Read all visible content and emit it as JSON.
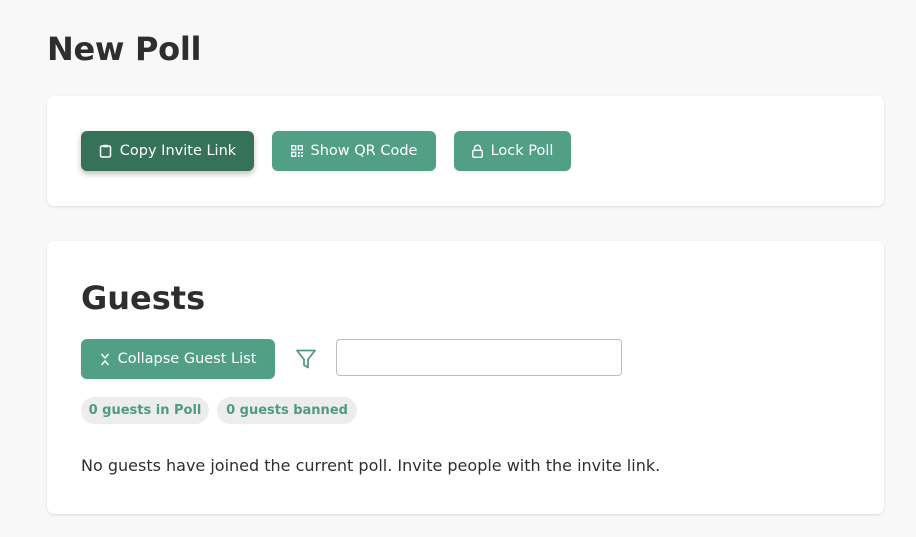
{
  "page": {
    "title": "New Poll"
  },
  "actions": {
    "copy_invite_label": "Copy Invite Link",
    "show_qr_label": "Show QR Code",
    "lock_poll_label": "Lock Poll"
  },
  "guests": {
    "title": "Guests",
    "collapse_label": "Collapse Guest List",
    "search_placeholder": "",
    "search_value": "",
    "guests_in_poll": "0 guests in Poll",
    "guests_banned": "0 guests banned",
    "empty_message": "No guests have joined the current poll. Invite people with the invite link."
  },
  "colors": {
    "primary": "#51a085",
    "primary_dark": "#367259",
    "pill_bg": "#ededed",
    "pill_text": "#4e9c80",
    "page_bg": "#f8f8f8"
  },
  "icons": {
    "copy": "clipboard-icon",
    "qr": "qr-code-icon",
    "lock": "lock-icon",
    "collapse": "collapse-icon",
    "filter": "filter-icon"
  }
}
